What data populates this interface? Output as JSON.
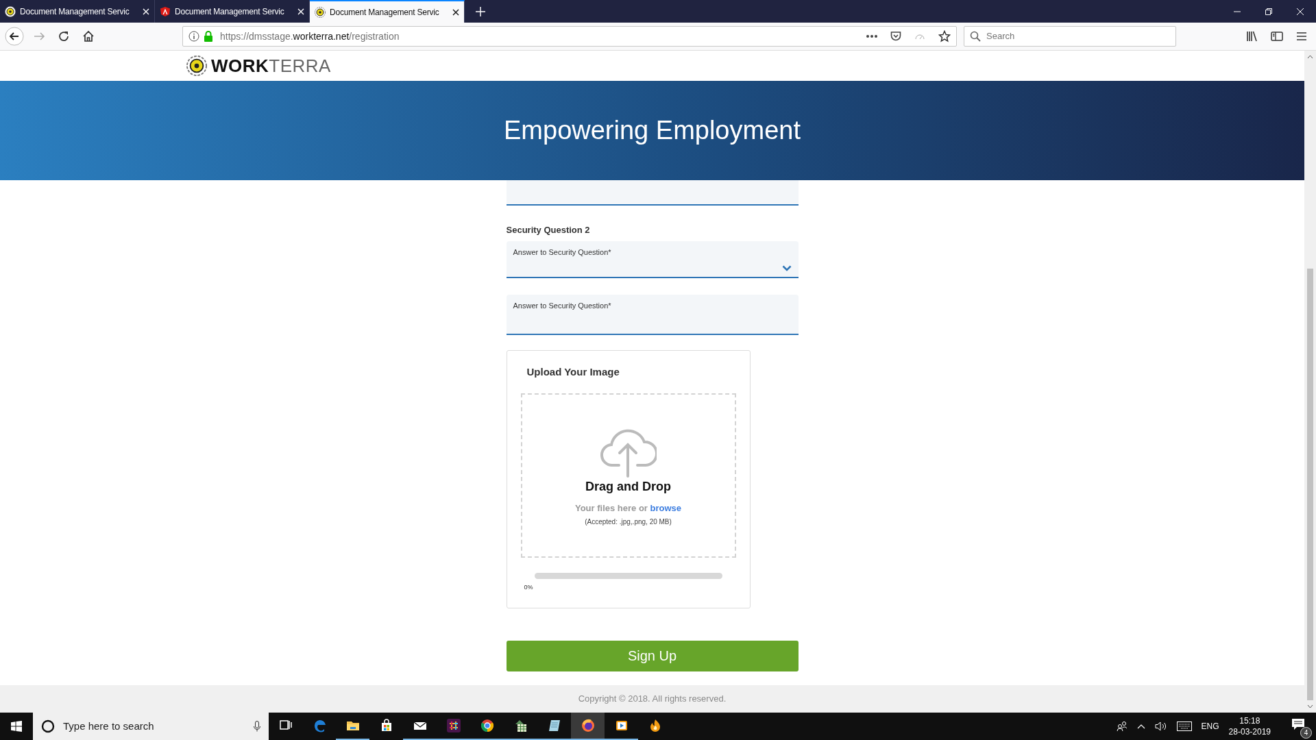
{
  "browser": {
    "tabs": [
      {
        "title": "Document Management Servic",
        "selected": false
      },
      {
        "title": "Document Management Servic",
        "selected": false
      },
      {
        "title": "Document Management Servic",
        "selected": true
      }
    ],
    "url": {
      "scheme": "https://dmsstage.",
      "domain": "workterra.net",
      "path": "/registration"
    },
    "search": {
      "placeholder": "Search"
    }
  },
  "page": {
    "logo": "**WORK**TERRA",
    "banner_title": "Empowering Employment",
    "form": {
      "section_title": "Security Question 2",
      "fields": [
        {
          "kind": "select",
          "label": "Answer to Security Question*"
        },
        {
          "kind": "input",
          "label": "Answer to Security Question*"
        }
      ]
    },
    "upload": {
      "title": "Upload Your Image",
      "heading": "Drag and Drop",
      "text": "Your files here or ",
      "link": "browse",
      "note": "(Accepted: .jpg,.png, 20 MB)",
      "progress": {
        "level": 0,
        "reading": "0%"
      }
    },
    "submit": "Sign Up",
    "footer": "Copyright © 2018. All rights reserved."
  },
  "taskbar": {
    "search": {
      "placeholder": "Type here to search"
    },
    "apps": [
      {
        "kind": "task-view",
        "running": false,
        "selected": false
      },
      {
        "kind": "edge",
        "running": false,
        "selected": false
      },
      {
        "kind": "folder",
        "running": true,
        "selected": false
      },
      {
        "kind": "store",
        "running": false,
        "selected": false
      },
      {
        "kind": "mail",
        "running": true,
        "selected": false
      },
      {
        "kind": "slack",
        "running": true,
        "selected": false
      },
      {
        "kind": "chrome",
        "running": true,
        "selected": false
      },
      {
        "kind": "spreadsheet",
        "running": true,
        "selected": false
      },
      {
        "kind": "notepad",
        "running": true,
        "selected": false
      },
      {
        "kind": "firefox",
        "running": true,
        "selected": true
      },
      {
        "kind": "player",
        "running": true,
        "selected": false
      },
      {
        "kind": "flame",
        "running": false,
        "selected": false
      }
    ],
    "language": "ENG",
    "time": "15:18",
    "date": "28-03-2019",
    "notifications": "4"
  }
}
